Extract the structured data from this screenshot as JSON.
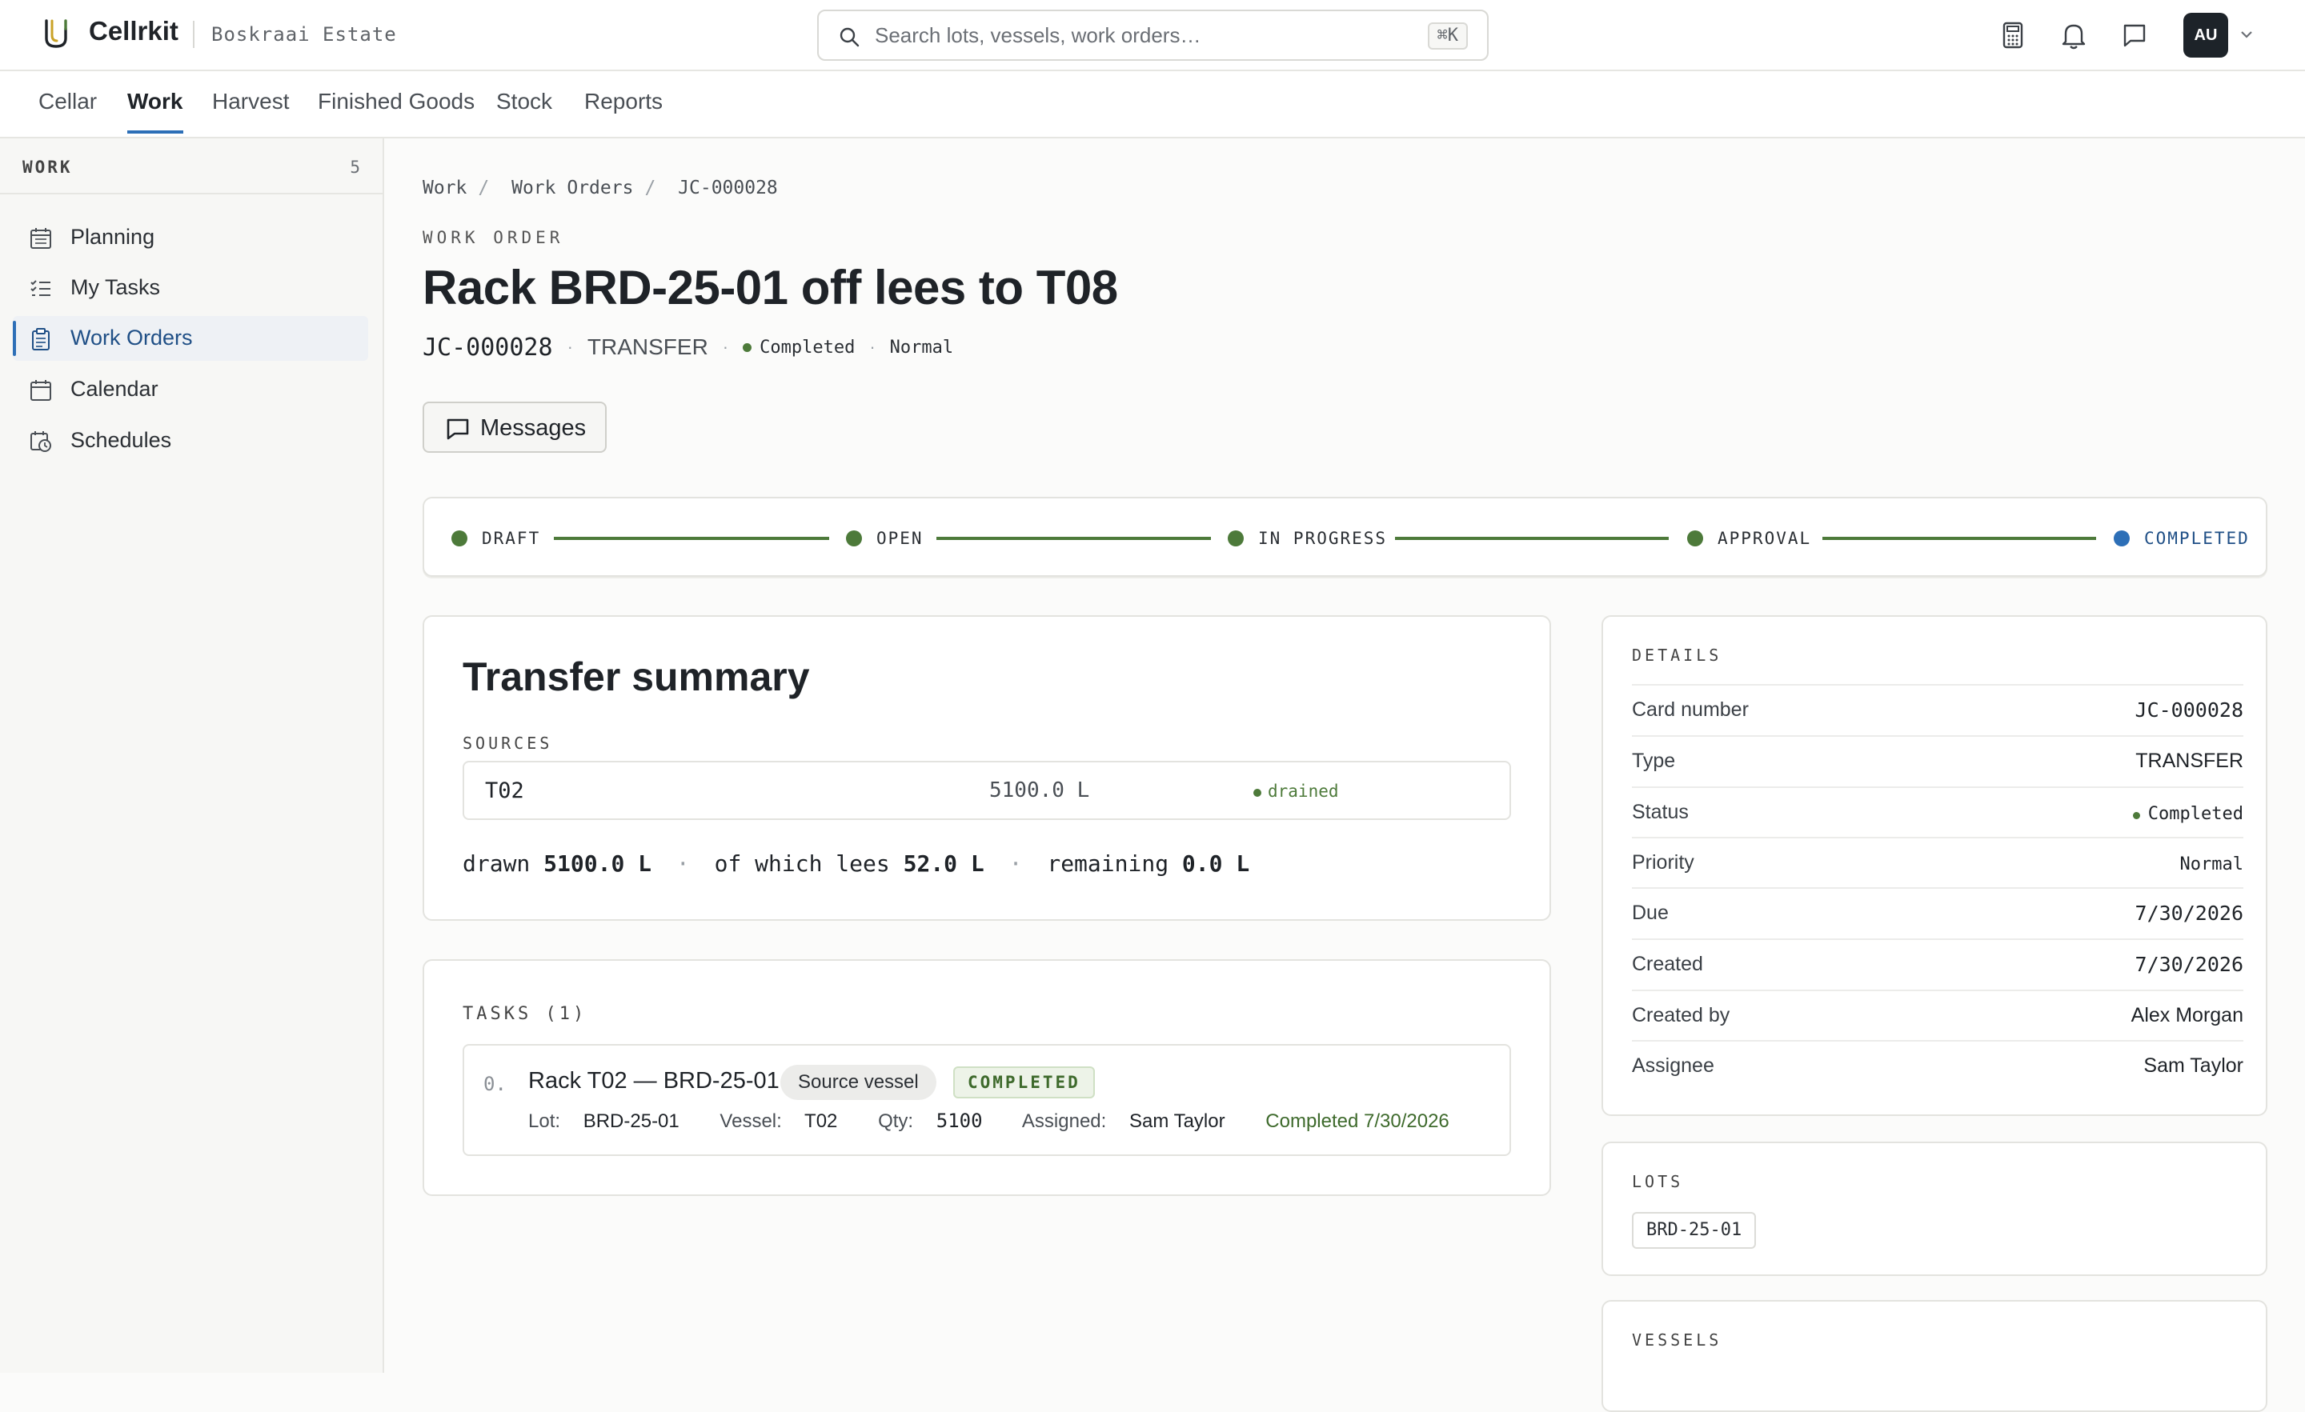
{
  "app": {
    "name": "Cellrkit",
    "estate": "Boskraai Estate"
  },
  "search": {
    "placeholder": "Search lots, vessels, work orders…",
    "shortcut": "⌘K"
  },
  "user": {
    "initials": "AU"
  },
  "nav": {
    "tabs": [
      "Cellar",
      "Work",
      "Harvest",
      "Finished Goods",
      "Stock",
      "Reports"
    ],
    "active": "Work"
  },
  "sidebar": {
    "title": "WORK",
    "count": "5",
    "items": [
      {
        "label": "Planning",
        "icon": "calendar-grid-icon"
      },
      {
        "label": "My Tasks",
        "icon": "checklist-icon"
      },
      {
        "label": "Work Orders",
        "icon": "clipboard-icon",
        "active": true
      },
      {
        "label": "Calendar",
        "icon": "calendar-icon"
      },
      {
        "label": "Schedules",
        "icon": "calendar-clock-icon"
      }
    ]
  },
  "breadcrumb": [
    "Work",
    "Work Orders",
    "JC-000028"
  ],
  "page": {
    "eyebrow": "WORK ORDER",
    "title": "Rack BRD-25-01 off lees to T08",
    "code": "JC-000028",
    "type": "TRANSFER",
    "status": "Completed",
    "priority": "Normal",
    "messages_label": "Messages"
  },
  "stepper": {
    "steps": [
      "DRAFT",
      "OPEN",
      "IN PROGRESS",
      "APPROVAL",
      "COMPLETED"
    ],
    "current": "COMPLETED",
    "colors": {
      "done": "#4d7a3a",
      "current": "#2d6fb7"
    }
  },
  "summary": {
    "title": "Transfer summary",
    "sources_label": "SOURCES",
    "sources": [
      {
        "vessel": "T02",
        "qty": "5100.0 L",
        "state": "drained"
      }
    ],
    "drawn_label": "drawn",
    "drawn": "5100.0 L",
    "lees_label": "of which lees",
    "lees": "52.0 L",
    "remaining_label": "remaining",
    "remaining": "0.0 L"
  },
  "tasks": {
    "label": "TASKS (1)",
    "items": [
      {
        "index": "0.",
        "title": "Rack T02 — BRD-25-01",
        "chip": "Source vessel",
        "badge": "COMPLETED",
        "lot_label": "Lot:",
        "lot": "BRD-25-01",
        "vessel_label": "Vessel:",
        "vessel": "T02",
        "qty_label": "Qty:",
        "qty": "5100",
        "assigned_label": "Assigned:",
        "assigned": "Sam Taylor",
        "completed": "Completed 7/30/2026"
      }
    ]
  },
  "details": {
    "label": "DETAILS",
    "rows": [
      {
        "key": "Card number",
        "value": "JC-000028"
      },
      {
        "key": "Type",
        "value": "TRANSFER"
      },
      {
        "key": "Status",
        "value": "Completed"
      },
      {
        "key": "Priority",
        "value": "Normal"
      },
      {
        "key": "Due",
        "value": "7/30/2026"
      },
      {
        "key": "Created",
        "value": "7/30/2026"
      },
      {
        "key": "Created by",
        "value": "Alex Morgan"
      },
      {
        "key": "Assignee",
        "value": "Sam Taylor"
      }
    ]
  },
  "lots": {
    "label": "LOTS",
    "items": [
      "BRD-25-01"
    ]
  },
  "vessels": {
    "label": "VESSELS"
  }
}
